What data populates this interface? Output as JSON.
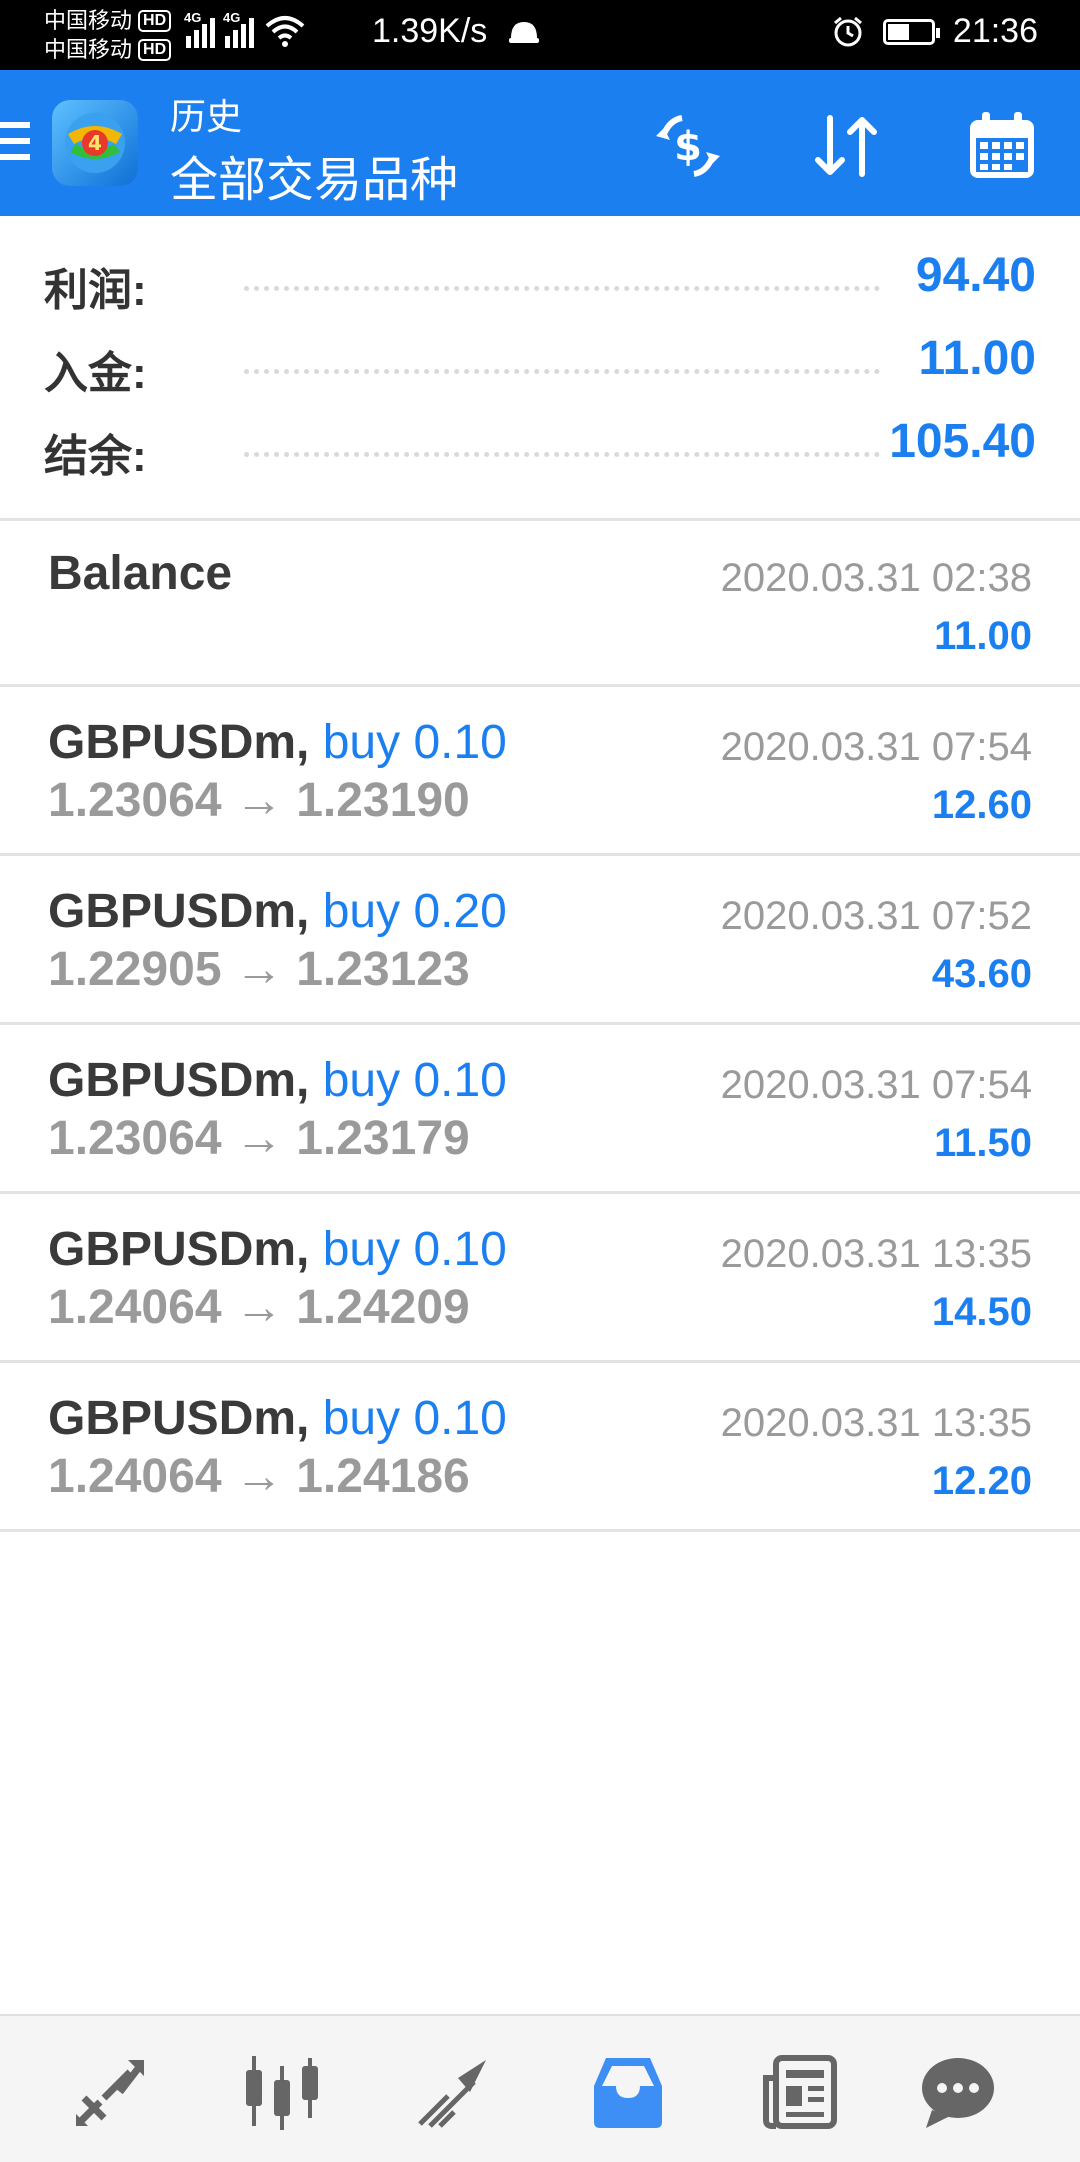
{
  "status_bar": {
    "carrier1": "中国移动",
    "carrier2": "中国移动",
    "hd": "HD",
    "net_tag": "4G",
    "speed": "1.39K/s",
    "time": "21:36",
    "battery_level": 0.5,
    "icons": [
      "signal-icon",
      "signal-icon",
      "wifi-icon",
      "notification-icon",
      "alarm-icon",
      "battery-icon"
    ]
  },
  "app_bar": {
    "subtitle": "历史",
    "title": "全部交易品种",
    "icons": [
      "menu-icon",
      "app-logo",
      "currency-exchange-icon",
      "sort-icon",
      "calendar-icon"
    ]
  },
  "summary": {
    "profit_label": "利润:",
    "profit_value": "94.40",
    "deposit_label": "入金:",
    "deposit_value": "11.00",
    "balance_label": "结余:",
    "balance_value": "105.40"
  },
  "history": [
    {
      "symbol": "Balance",
      "side": "",
      "open": "",
      "close": "",
      "time": "2020.03.31 02:38",
      "profit": "11.00"
    },
    {
      "symbol": "GBPUSDm,",
      "side": "buy 0.10",
      "open": "1.23064",
      "close": "1.23190",
      "time": "2020.03.31 07:54",
      "profit": "12.60"
    },
    {
      "symbol": "GBPUSDm,",
      "side": "buy 0.20",
      "open": "1.22905",
      "close": "1.23123",
      "time": "2020.03.31 07:52",
      "profit": "43.60"
    },
    {
      "symbol": "GBPUSDm,",
      "side": "buy 0.10",
      "open": "1.23064",
      "close": "1.23179",
      "time": "2020.03.31 07:54",
      "profit": "11.50"
    },
    {
      "symbol": "GBPUSDm,",
      "side": "buy 0.10",
      "open": "1.24064",
      "close": "1.24209",
      "time": "2020.03.31 13:35",
      "profit": "14.50"
    },
    {
      "symbol": "GBPUSDm,",
      "side": "buy 0.10",
      "open": "1.24064",
      "close": "1.24186",
      "time": "2020.03.31 13:35",
      "profit": "12.20"
    }
  ],
  "arrow": "→",
  "bottom_nav": {
    "items": [
      "quotes-icon",
      "chart-icon",
      "trade-icon",
      "history-icon",
      "news-icon",
      "chat-icon"
    ],
    "active": "history-icon",
    "active_color": "#3d8ef5",
    "inactive_color": "#666666"
  },
  "colors": {
    "accent": "#1b7ff0",
    "text_dark": "#333333",
    "text_gray": "#9a9a9a"
  }
}
